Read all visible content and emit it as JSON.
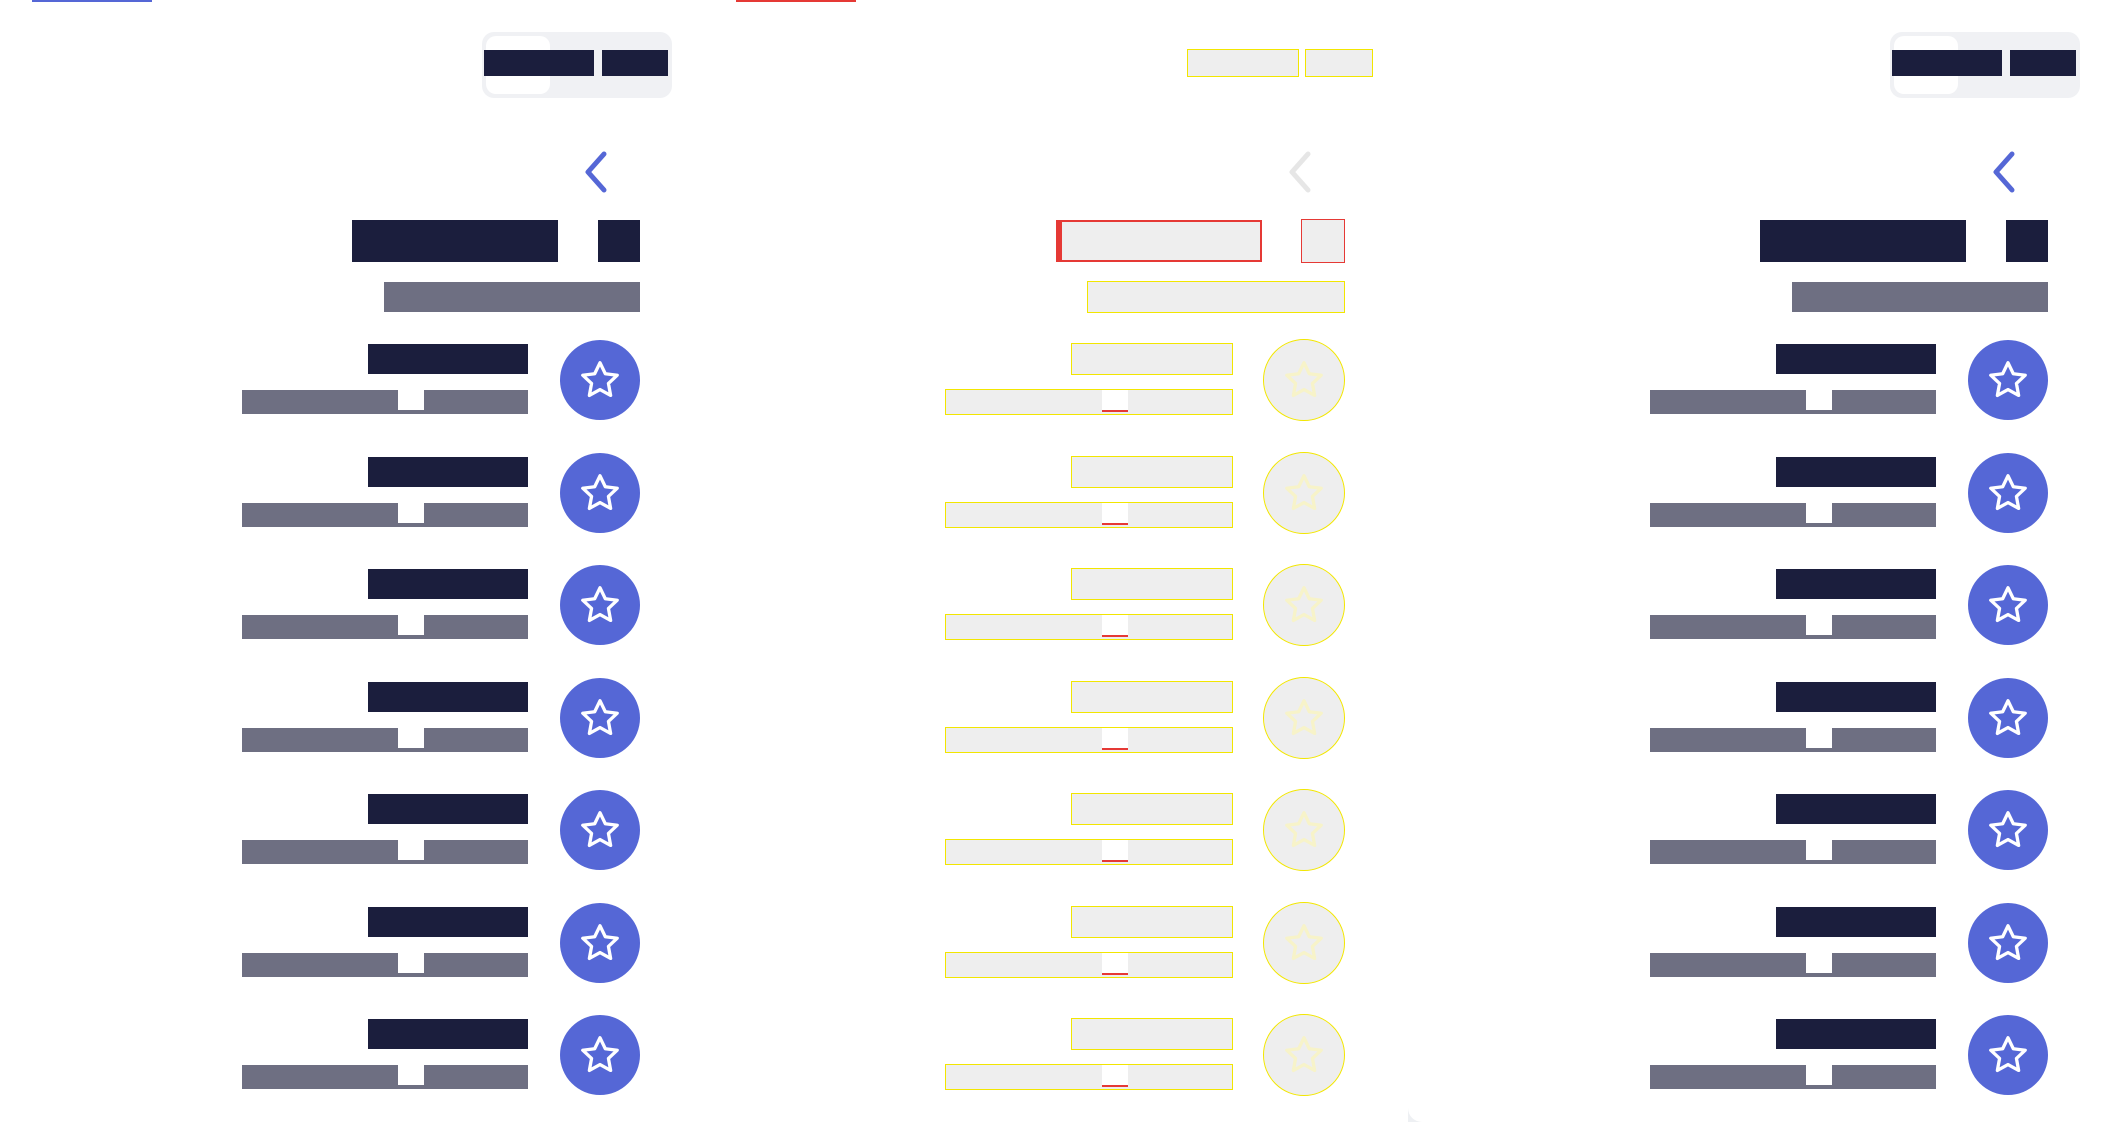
{
  "colors": {
    "accent": "#5567d6",
    "text_dark": "#1b1e3d",
    "text_muted": "#6e6f82",
    "debug_outline": "#f2e600",
    "debug_error": "#e53935"
  },
  "panels": [
    {
      "variant": "normal"
    },
    {
      "variant": "outline-debug"
    },
    {
      "variant": "normal"
    }
  ],
  "toggle": {
    "option_1": "",
    "option_2": ""
  },
  "header": {
    "back_icon": "chevron-left-icon",
    "title": "",
    "count": "",
    "subtitle": ""
  },
  "list": {
    "favorite_icon": "star-icon",
    "items": [
      {
        "name": "",
        "meta": ""
      },
      {
        "name": "",
        "meta": ""
      },
      {
        "name": "",
        "meta": ""
      },
      {
        "name": "",
        "meta": ""
      },
      {
        "name": "",
        "meta": ""
      },
      {
        "name": "",
        "meta": ""
      },
      {
        "name": "",
        "meta": ""
      }
    ]
  }
}
